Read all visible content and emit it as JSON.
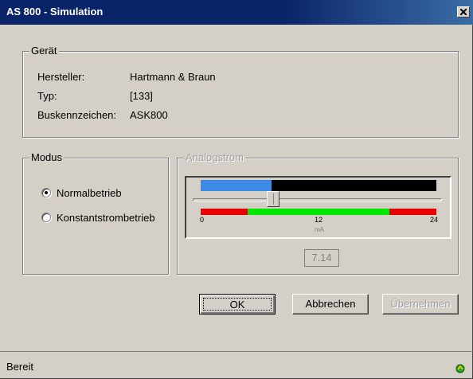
{
  "window": {
    "title": "AS 800 - Simulation"
  },
  "device": {
    "group_label": "Gerät",
    "rows": [
      {
        "label": "Hersteller:",
        "value": "Hartmann & Braun"
      },
      {
        "label": "Typ:",
        "value": "[133]"
      },
      {
        "label": "Buskennzeichen:",
        "value": "ASK800"
      }
    ]
  },
  "mode": {
    "group_label": "Modus",
    "options": [
      {
        "label": "Normalbetrieb",
        "selected": true
      },
      {
        "label": "Konstantstrombetrieb",
        "selected": false
      }
    ]
  },
  "analog": {
    "group_label": "Analogstrom",
    "min": 0,
    "max": 24,
    "current_value": 7.14,
    "current_value_text": "7.14",
    "bar_fill_fraction": 0.3,
    "tick_labels": [
      "0",
      "12",
      "24"
    ],
    "unit": "mA",
    "colors": {
      "bar": "#3c8ce6",
      "red_zone": "#e60000",
      "green_zone": "#00e600"
    }
  },
  "buttons": {
    "ok": "OK",
    "cancel": "Abbrechen",
    "apply": "Übernehmen"
  },
  "status": {
    "text": "Bereit",
    "icon": "green-connection-icon"
  }
}
